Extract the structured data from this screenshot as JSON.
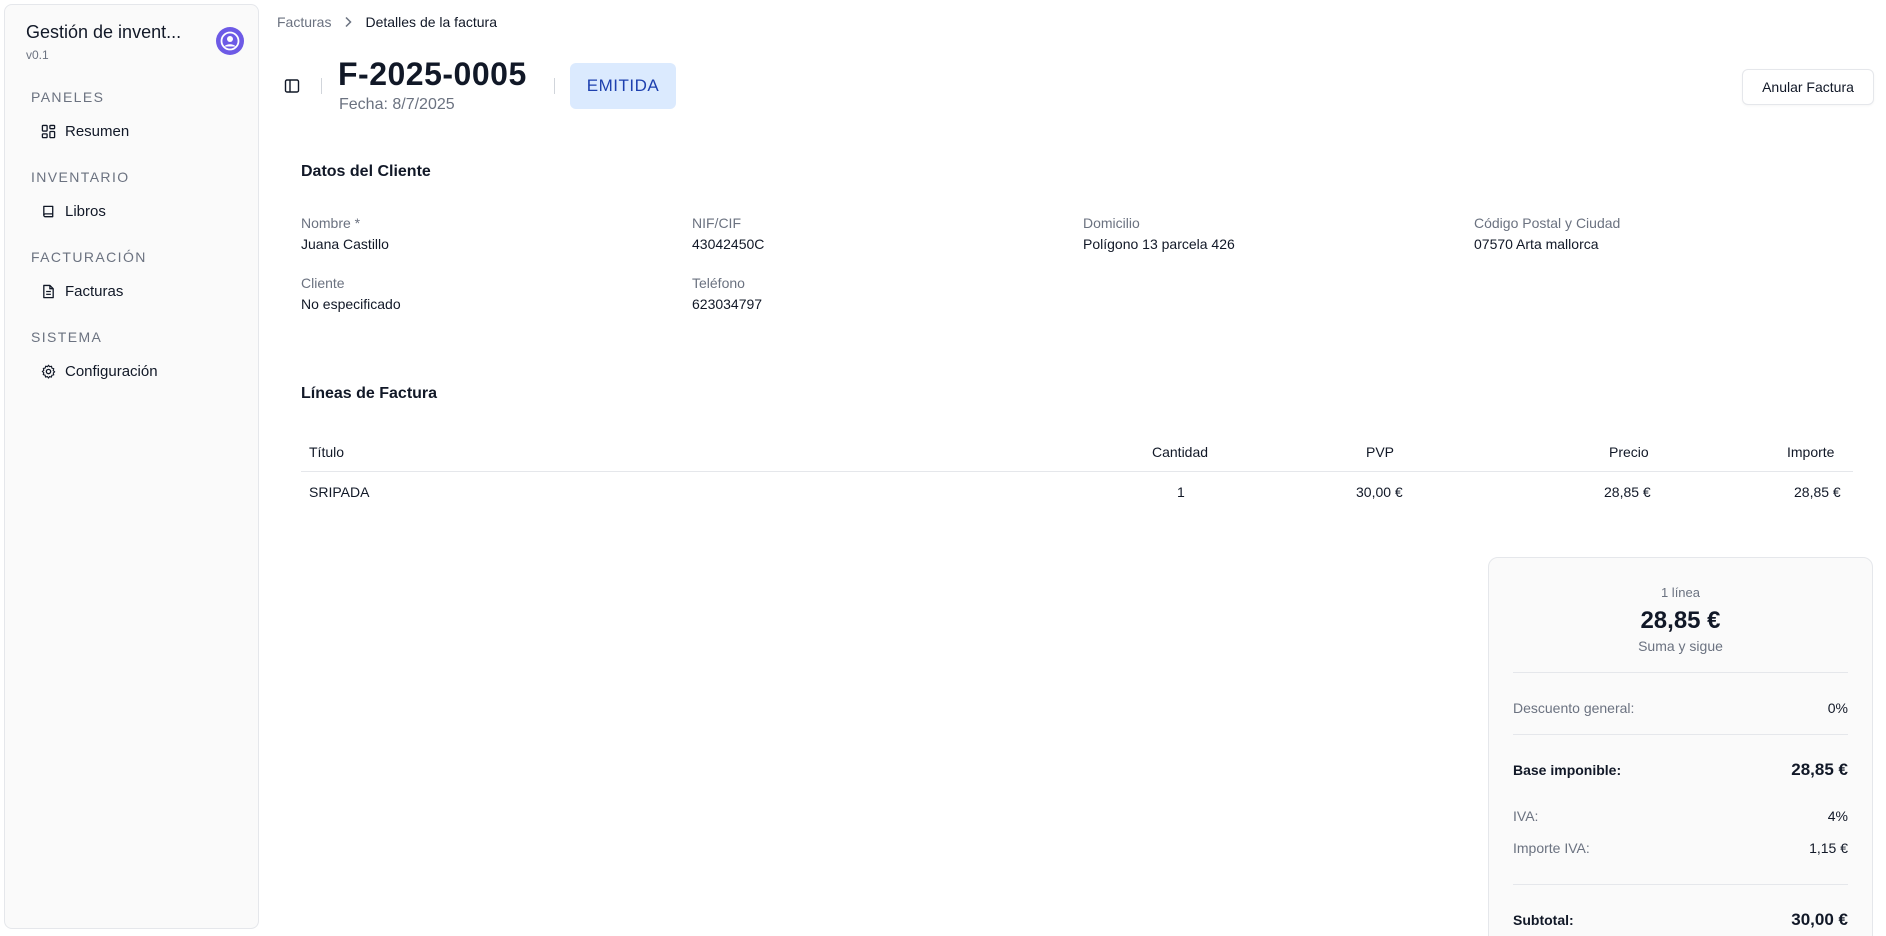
{
  "app": {
    "title": "Gestión de invent...",
    "version": "v0.1"
  },
  "sidebar": {
    "groups": [
      {
        "label": "PANELES",
        "items": [
          {
            "label": "Resumen",
            "icon": "dashboard-icon"
          }
        ]
      },
      {
        "label": "INVENTARIO",
        "items": [
          {
            "label": "Libros",
            "icon": "book-icon"
          }
        ]
      },
      {
        "label": "FACTURACIÓN",
        "items": [
          {
            "label": "Facturas",
            "icon": "file-text-icon"
          }
        ]
      },
      {
        "label": "SISTEMA",
        "items": [
          {
            "label": "Configuración",
            "icon": "gear-icon"
          }
        ]
      }
    ]
  },
  "breadcrumb": {
    "parent": "Facturas",
    "current": "Detalles de la factura"
  },
  "invoice": {
    "number": "F-2025-0005",
    "date": "Fecha: 8/7/2025",
    "status": "EMITIDA",
    "void_label": "Anular Factura"
  },
  "client": {
    "section_title": "Datos del Cliente",
    "fields": {
      "name": {
        "label": "Nombre *",
        "value": "Juana Castillo"
      },
      "nif": {
        "label": "NIF/CIF",
        "value": "43042450C"
      },
      "address": {
        "label": "Domicilio",
        "value": "Polígono 13 parcela 426"
      },
      "postal": {
        "label": "Código Postal y Ciudad",
        "value": "07570 Arta mallorca"
      },
      "client": {
        "label": "Cliente",
        "value": "No especificado"
      },
      "phone": {
        "label": "Teléfono",
        "value": "623034797"
      }
    }
  },
  "lines": {
    "section_title": "Líneas de Factura",
    "headers": {
      "title": "Título",
      "qty": "Cantidad",
      "pvp": "PVP",
      "price": "Precio",
      "amount": "Importe"
    },
    "rows": [
      {
        "title": "SRIPADA",
        "qty": "1",
        "pvp": "30,00 €",
        "price": "28,85 €",
        "amount": "28,85 €"
      }
    ]
  },
  "summary": {
    "line_count": "1 línea",
    "total": "28,85 €",
    "note": "Suma y sigue",
    "discount": {
      "label": "Descuento general:",
      "value": "0%"
    },
    "base": {
      "label": "Base imponible:",
      "value": "28,85 €"
    },
    "iva": {
      "label": "IVA:",
      "value": "4%"
    },
    "iva_amount": {
      "label": "Importe IVA:",
      "value": "1,15 €"
    },
    "subtotal": {
      "label": "Subtotal:",
      "value": "30,00 €"
    }
  },
  "colors": {
    "accent": "#6d5ae6",
    "status_bg": "#dbeafe",
    "status_text": "#1e40af"
  }
}
